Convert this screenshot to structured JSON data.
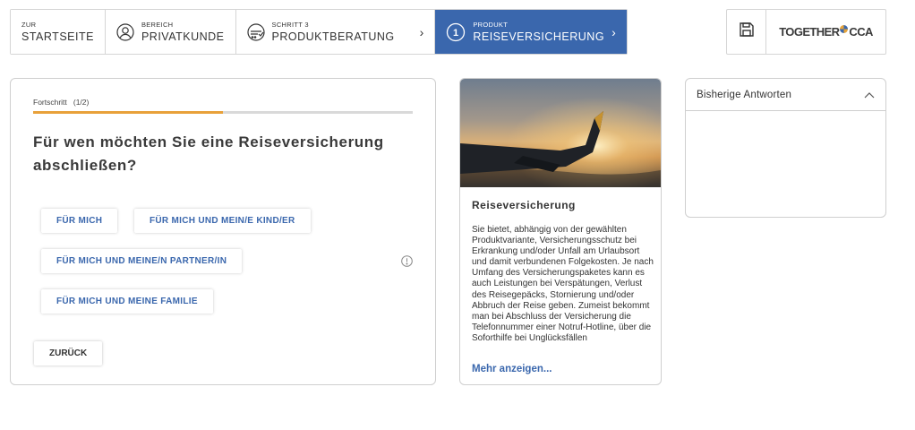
{
  "nav": {
    "items": [
      {
        "small": "ZUR",
        "large": "STARTSEITE",
        "icon": "none"
      },
      {
        "small": "BEREICH",
        "large": "PRIVATKUNDE",
        "icon": "person-icon"
      },
      {
        "small": "SCHRITT 3",
        "large": "PRODUKTBERATUNG",
        "icon": "consultation-icon"
      },
      {
        "small": "PRODUKT",
        "large": "REISEVERSICHERUNG",
        "icon": "step-number-icon",
        "number": "1"
      }
    ]
  },
  "toolbar": {
    "save_icon": "floppy-disk-icon",
    "logo": {
      "left": "TOGETHER",
      "right": "CCA"
    }
  },
  "question_card": {
    "progress_label": "Fortschritt",
    "progress_count": "(1/2)",
    "progress_fraction": 0.5,
    "question": "Für wen möchten Sie eine Reiseversicherung abschließen?",
    "options": [
      "FÜR MICH",
      "FÜR MICH UND MEIN/E KIND/ER",
      "FÜR MICH UND MEINE/N PARTNER/IN",
      "FÜR MICH UND MEINE FAMILIE"
    ],
    "back_label": "ZURÜCK"
  },
  "info_card": {
    "title": "Reiseversicherung",
    "text": "Sie bietet, abhängig von der gewählten Produktvariante, Versicherungsschutz bei Erkrankung und/oder Unfall am Urlaubsort und damit verbundenen Folgekosten. Je nach Umfang des Versicherungspaketes kann es auch Leistungen bei Verspätungen, Verlust des Reisegepäcks, Stornierung und/oder Abbruch der Reise geben. Zumeist bekommt man bei Abschluss der Versicherung die Telefonnummer einer Notruf-Hotline, über die Soforthilfe bei Unglücksfällen",
    "more_label": "Mehr anzeigen..."
  },
  "answers_panel": {
    "title": "Bisherige Antworten"
  },
  "colors": {
    "accent_blue": "#3a67ad",
    "progress_orange": "#e8a13a"
  }
}
